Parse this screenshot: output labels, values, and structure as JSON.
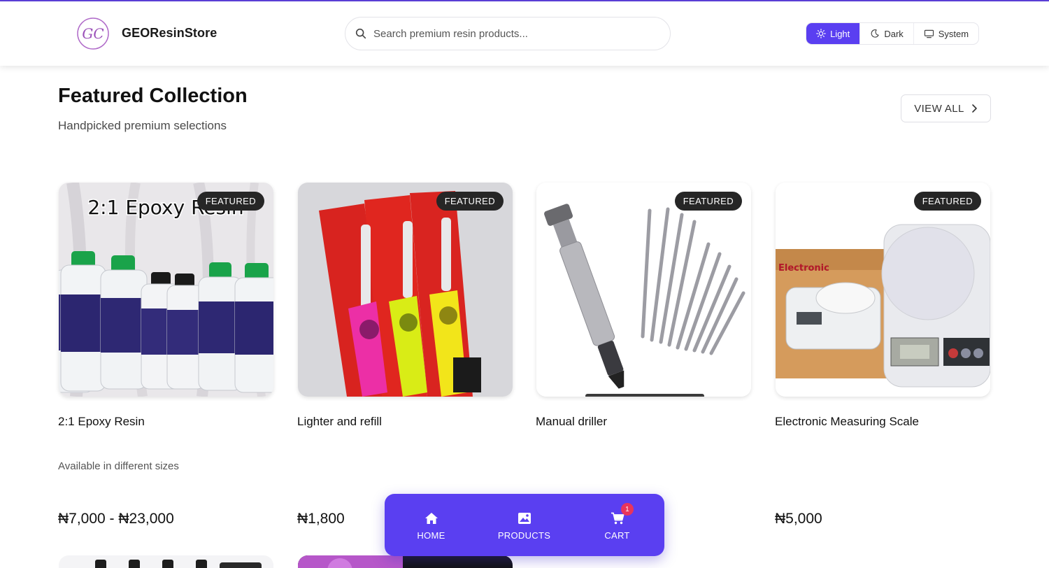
{
  "header": {
    "brand_name": "GEOResinStore",
    "logo_text": "GC",
    "search_placeholder": "Search premium resin products...",
    "theme_options": [
      "Light",
      "Dark",
      "System"
    ],
    "active_theme": "Light"
  },
  "section": {
    "title": "Featured Collection",
    "subtitle": "Handpicked premium selections",
    "view_all_label": "VIEW ALL"
  },
  "products": [
    {
      "badge": "FEATURED",
      "name": "2:1 Epoxy Resin",
      "description": "Available in different sizes",
      "price": "₦7,000 - ₦23,000",
      "image_caption": "2:1 Epoxy Resin",
      "image": "epoxy-bottles"
    },
    {
      "badge": "FEATURED",
      "name": "Lighter and refill",
      "description": "",
      "price": "₦1,800",
      "image": "lighters"
    },
    {
      "badge": "FEATURED",
      "name": "Manual driller",
      "description": "",
      "price": "",
      "image": "hand-drill-bits"
    },
    {
      "badge": "FEATURED",
      "name": "Electronic Measuring Scale",
      "description": "",
      "price": "₦5,000",
      "image": "kitchen-scale"
    }
  ],
  "bottom_nav": {
    "items": [
      {
        "label": "HOME",
        "icon": "home-icon"
      },
      {
        "label": "PRODUCTS",
        "icon": "image-icon"
      },
      {
        "label": "CART",
        "icon": "cart-icon"
      }
    ],
    "cart_count": "1"
  },
  "colors": {
    "accent": "#5a3ff1",
    "badge_bg": "#262626",
    "cart_badge": "#e8345c"
  }
}
